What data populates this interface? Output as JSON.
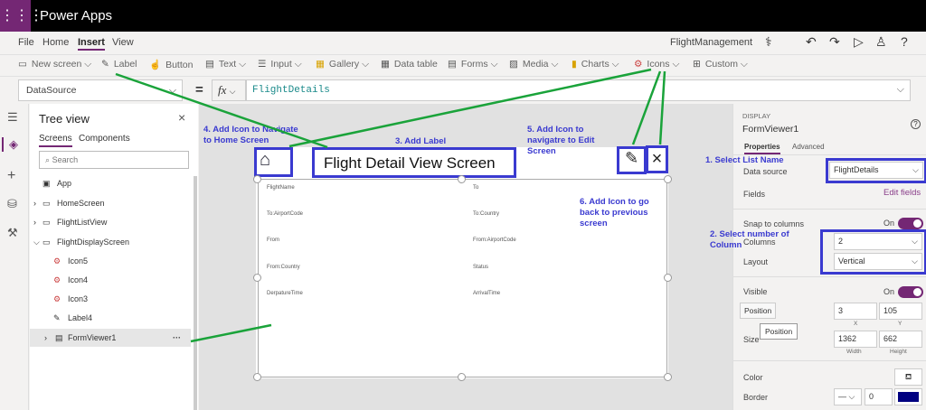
{
  "app": {
    "title": "Power Apps",
    "launcher_icon": "waffle-icon",
    "project": "FlightManagement"
  },
  "menu": [
    "File",
    "Home",
    "Insert",
    "View"
  ],
  "toolbar": {
    "new_screen": "New screen",
    "label": "Label",
    "button": "Button",
    "text": "Text",
    "input": "Input",
    "gallery": "Gallery",
    "data_table": "Data table",
    "forms": "Forms",
    "media": "Media",
    "charts": "Charts",
    "icons": "Icons",
    "custom": "Custom"
  },
  "formula_bar": {
    "property": "DataSource",
    "equals": "=",
    "fx": "fx",
    "value": "FlightDetails"
  },
  "tree": {
    "title": "Tree view",
    "tabs": [
      "Screens",
      "Components"
    ],
    "search_placeholder": "Search",
    "items": [
      "App",
      "HomeScreen",
      "FlightListView",
      "FlightDisplayScreen",
      "Icon5",
      "Icon4",
      "Icon3",
      "Label4",
      "FormViewer1"
    ],
    "more": "···"
  },
  "screen": {
    "title": "Flight Detail View Screen",
    "fields_left": [
      "FlightName",
      "To:AirportCode",
      "From",
      "From:Country",
      "DerpatureTime"
    ],
    "fields_right": [
      "To",
      "To:Country",
      "From:AirportCode",
      "Status",
      "ArrivalTime"
    ]
  },
  "annotations": {
    "a1": "1. Select List Name",
    "a2": "2. Select number of Column",
    "a3": "3. Add Label",
    "a4": "4. Add Icon to Navigate to Home Screen",
    "a5": "5. Add Icon to navigatre to Edit Screen",
    "a6": "6. Add Icon to go back to previous screen"
  },
  "props": {
    "category": "DISPLAY",
    "name": "FormViewer1",
    "tabs": [
      "Properties",
      "Advanced"
    ],
    "data_source_label": "Data source",
    "data_source": "FlightDetails",
    "fields_label": "Fields",
    "edit_fields": "Edit fields",
    "snap_label": "Snap to columns",
    "snap_value": "On",
    "columns_label": "Columns",
    "columns": "2",
    "layout_label": "Layout",
    "layout": "Vertical",
    "visible_label": "Visible",
    "visible_value": "On",
    "position_label": "Position",
    "position_tooltip": "Position",
    "x": "3",
    "y": "105",
    "x_label": "X",
    "y_label": "Y",
    "size_label": "Size",
    "width": "1362",
    "height": "662",
    "width_label": "Width",
    "height_label": "Height",
    "color_label": "Color",
    "border_label": "Border",
    "border_width": "0",
    "border_color": "#000080"
  },
  "colors": {
    "accent": "#742774",
    "annotation": "#3a3ad0",
    "arrow": "#1aa33a"
  }
}
